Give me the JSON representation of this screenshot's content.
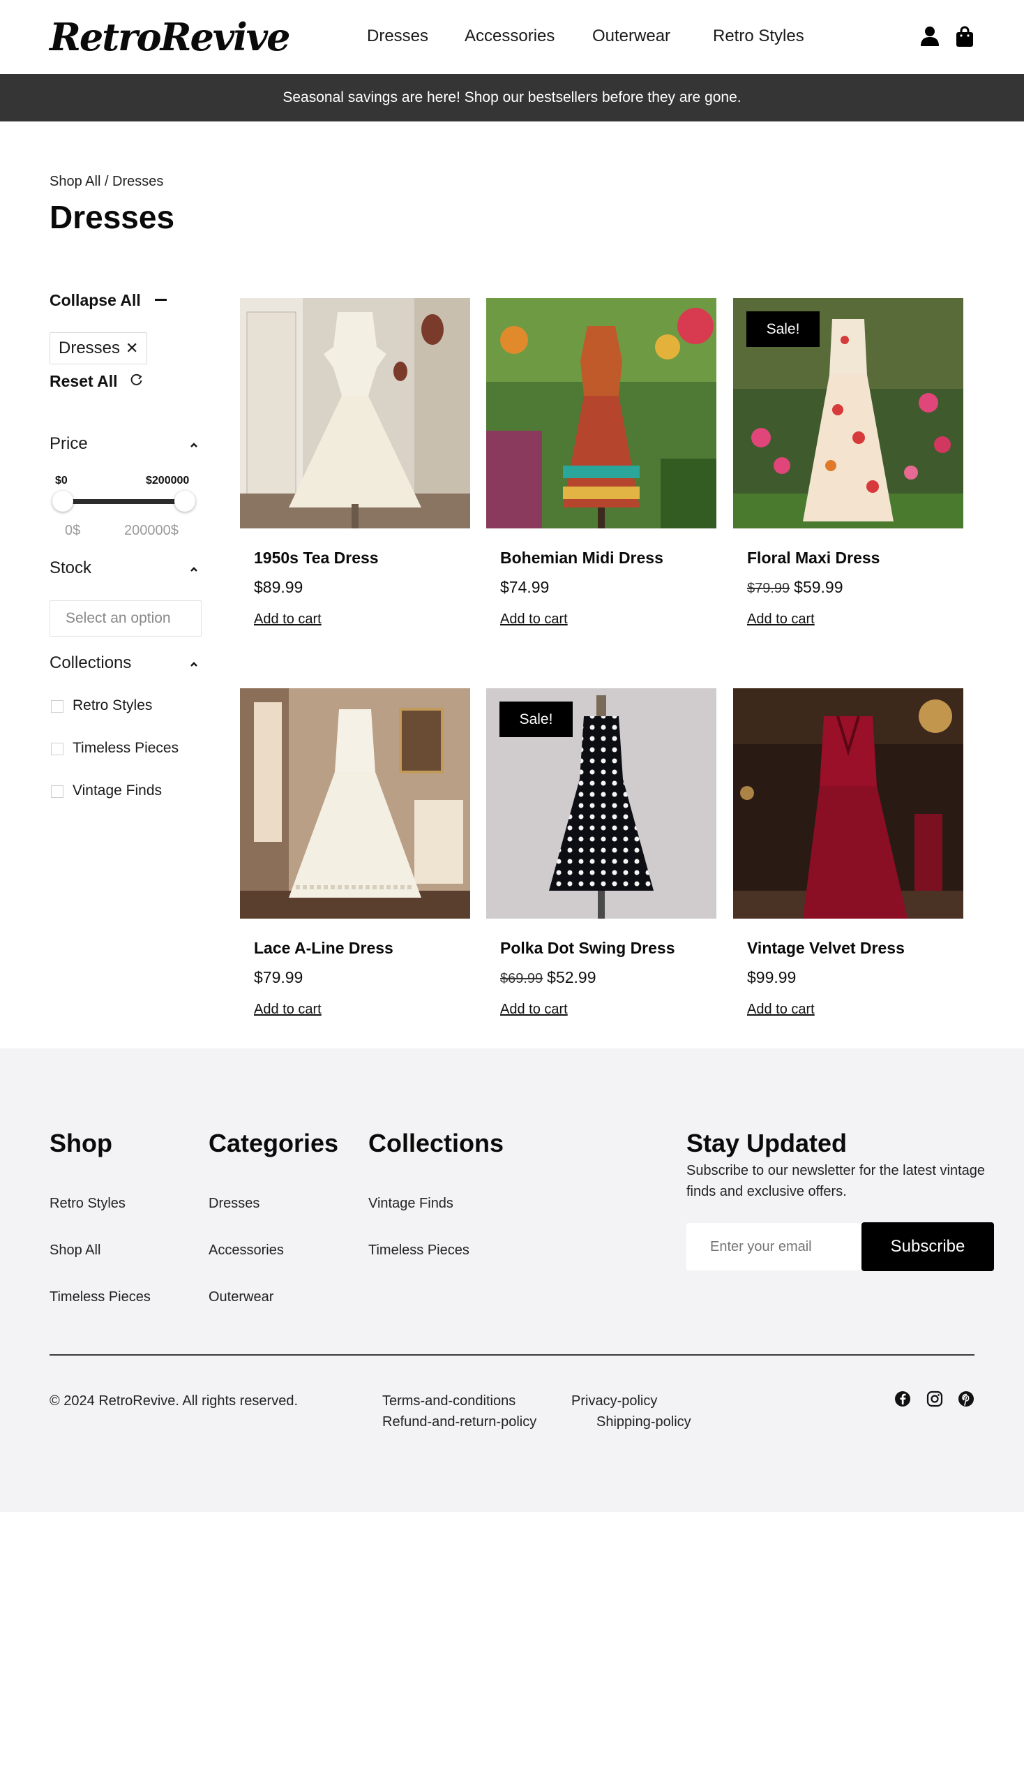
{
  "header": {
    "logo": "RetroRevive",
    "nav": [
      "Dresses",
      "Accessories",
      "Outerwear",
      "Retro Styles"
    ],
    "icons": [
      "user-icon",
      "shopping-bag-icon"
    ]
  },
  "banner": {
    "text": "Seasonal savings are here! Shop our bestsellers before they are gone."
  },
  "page": {
    "breadcrumb": "Shop All / Dresses",
    "title": "Dresses"
  },
  "filters": {
    "collapse_all": "Collapse All",
    "active_chip": "Dresses",
    "chip_remove": "✕",
    "reset_all": "Reset All",
    "price": {
      "label": "Price",
      "min_label": "$0",
      "max_label": "$200000",
      "min_input": "0$",
      "max_input": "200000$"
    },
    "stock": {
      "label": "Stock",
      "placeholder": "Select an option"
    },
    "collections": {
      "label": "Collections",
      "items": [
        "Retro Styles",
        "Timeless Pieces",
        "Vintage Finds"
      ]
    }
  },
  "products": [
    {
      "name": "1950s Tea Dress",
      "price": "$89.99",
      "old_price": "",
      "sale": "",
      "cart": "Add to cart"
    },
    {
      "name": "Bohemian Midi Dress",
      "price": "$74.99",
      "old_price": "",
      "sale": "",
      "cart": "Add to cart"
    },
    {
      "name": "Floral Maxi Dress",
      "price": "$59.99",
      "old_price": "$79.99",
      "sale": "Sale!",
      "cart": "Add to cart"
    },
    {
      "name": "Lace A-Line Dress",
      "price": "$79.99",
      "old_price": "",
      "sale": "",
      "cart": "Add to cart"
    },
    {
      "name": "Polka Dot Swing Dress",
      "price": "$52.99",
      "old_price": "$69.99",
      "sale": "Sale!",
      "cart": "Add to cart"
    },
    {
      "name": "Vintage Velvet Dress",
      "price": "$99.99",
      "old_price": "",
      "sale": "",
      "cart": "Add to cart"
    }
  ],
  "footer": {
    "shop": {
      "heading": "Shop",
      "links": [
        "Retro Styles",
        "Shop All",
        "Timeless Pieces"
      ]
    },
    "categories": {
      "heading": "Categories",
      "links": [
        "Dresses",
        "Accessories",
        "Outerwear"
      ]
    },
    "collections": {
      "heading": "Collections",
      "links": [
        "Vintage Finds",
        "Timeless Pieces"
      ]
    },
    "newsletter": {
      "heading": "Stay Updated",
      "text": "Subscribe to our newsletter for the latest vintage finds and exclusive offers.",
      "placeholder": "Enter your email",
      "button": "Subscribe"
    },
    "copyright": "© 2024 RetroRevive. All rights reserved.",
    "policies": [
      "Terms-and-conditions",
      "Privacy-policy",
      "Refund-and-return-policy",
      "Shipping-policy"
    ],
    "social_icons": [
      "facebook-icon",
      "instagram-icon",
      "pinterest-icon"
    ]
  },
  "colors": {
    "banner_bg": "#353535",
    "footer_bg": "#f3f3f5",
    "accent": "#000000"
  }
}
